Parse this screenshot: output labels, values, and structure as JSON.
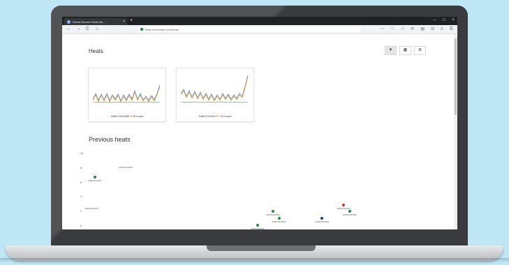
{
  "browser": {
    "tab_title": "Rinnai Sensor Heats list - ...",
    "tab_close": "×",
    "new_tab": "+",
    "window_controls": [
      "–",
      "□",
      "×"
    ],
    "nav_icons": [
      "←",
      "→",
      "C",
      "⌂"
    ],
    "url": "https://ci.heatdb.com/heats",
    "right_icons": [
      "⋯",
      "♡",
      "☆",
      "⟳",
      "▤",
      "⊡",
      "≡",
      "☰"
    ]
  },
  "page": {
    "heats_heading": "Heats",
    "previous_heading": "Previous heats",
    "view_toggle": [
      "▼",
      "▦",
      "≣"
    ],
    "cards": [
      {
        "caption": "2x8072310050",
        "duration": "20 hours"
      },
      {
        "caption": "2x8072310017",
        "duration": "32 hours"
      }
    ],
    "y_axis_ticks": [
      "10",
      "8",
      "6",
      "4",
      "2",
      "0"
    ],
    "scatter_points": [
      {
        "label": "2x8072310041",
        "color": "#1e8e3e",
        "x": 2,
        "y": 7
      },
      {
        "label": "2x8072310008",
        "color": "",
        "x": 12,
        "y": 9
      },
      {
        "label": "2x8072310037",
        "color": "",
        "x": 1,
        "y": 3
      },
      {
        "label": "2x8072310003",
        "color": "#1e8e3e",
        "x": 60,
        "y": 2
      },
      {
        "label": "2x8072310006",
        "color": "#1e8e3e",
        "x": 62,
        "y": 1
      },
      {
        "label": "2x8072310014",
        "color": "#1e8e3e",
        "x": 55,
        "y": 0
      },
      {
        "label": "2x8072310021",
        "color": "#1a3a8f",
        "x": 76,
        "y": 1
      },
      {
        "label": "2x8072310011",
        "color": "#d93025",
        "x": 83,
        "y": 3
      },
      {
        "label": "2x8072310033",
        "color": "#1e8e3e",
        "x": 85,
        "y": 2
      }
    ]
  },
  "colors": {
    "spark_blue": "#4c8bf5",
    "spark_orange": "#f29900",
    "spark_green": "#1e8e3e"
  }
}
